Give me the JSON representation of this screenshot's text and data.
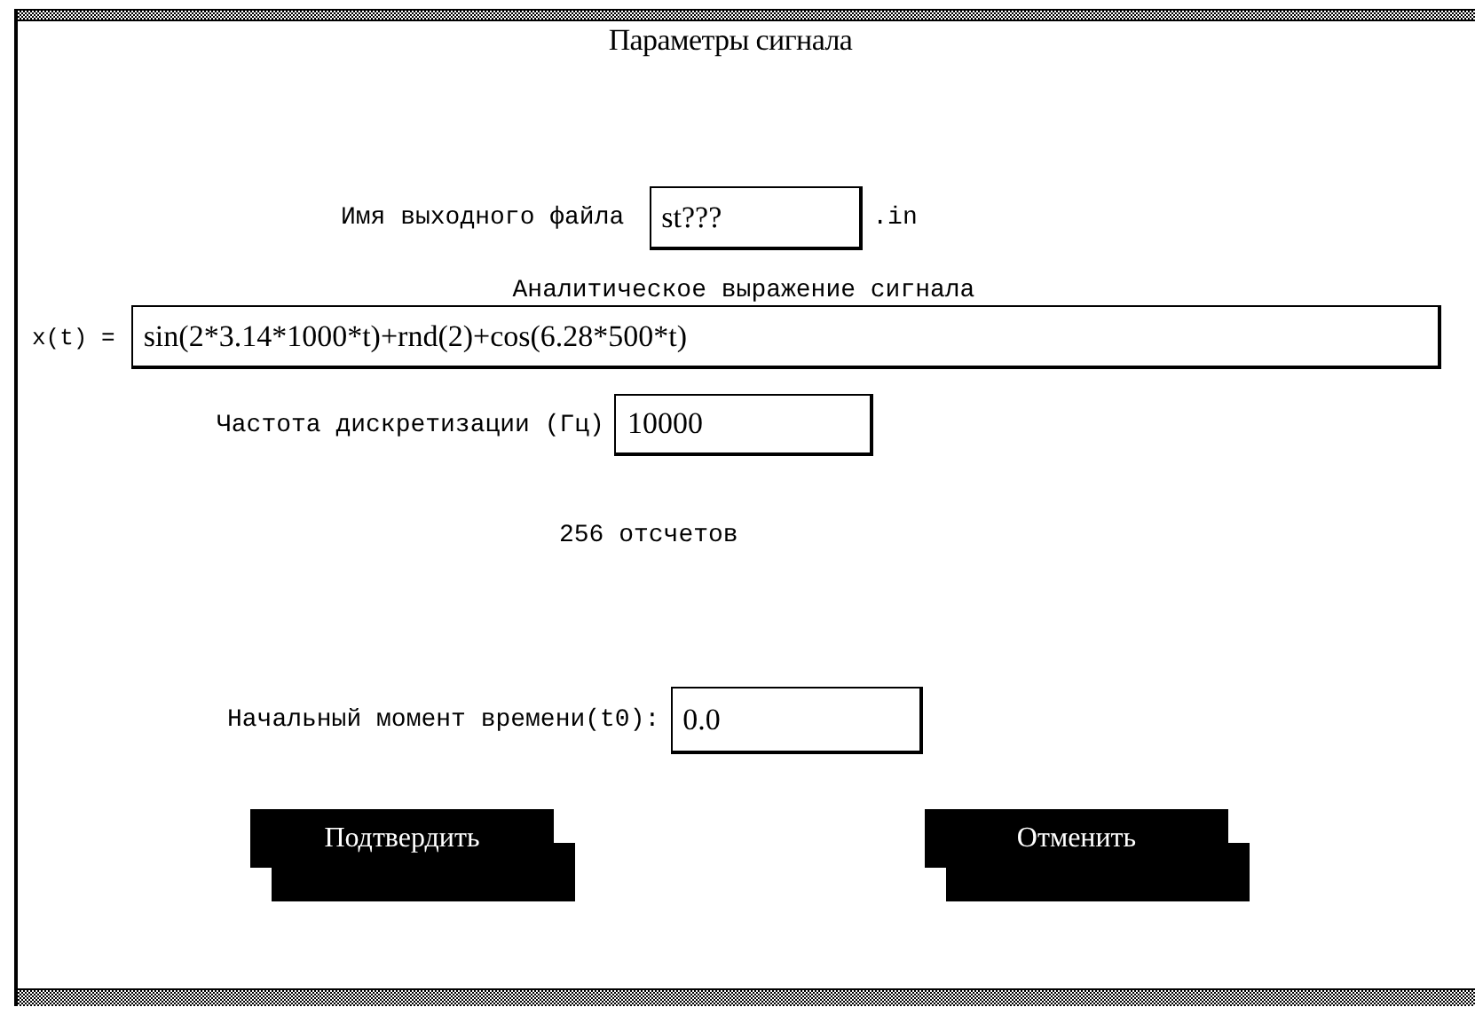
{
  "window": {
    "title": "Параметры сигнала"
  },
  "output_file": {
    "label": "Имя выходного файла",
    "value": "st???",
    "suffix": ".in"
  },
  "expression": {
    "heading": "Аналитическое выражение сигнала",
    "label": "x(t) =",
    "value": "sin(2*3.14*1000*t)+rnd(2)+cos(6.28*500*t)"
  },
  "sample_rate": {
    "label": "Частота дискретизации (Гц)",
    "value": "10000"
  },
  "sample_count": "256 отсчетов",
  "start_time": {
    "label": "Начальный момент времени(t0):",
    "value": "0.0"
  },
  "buttons": [
    "Подтвердить",
    "Отменить"
  ]
}
